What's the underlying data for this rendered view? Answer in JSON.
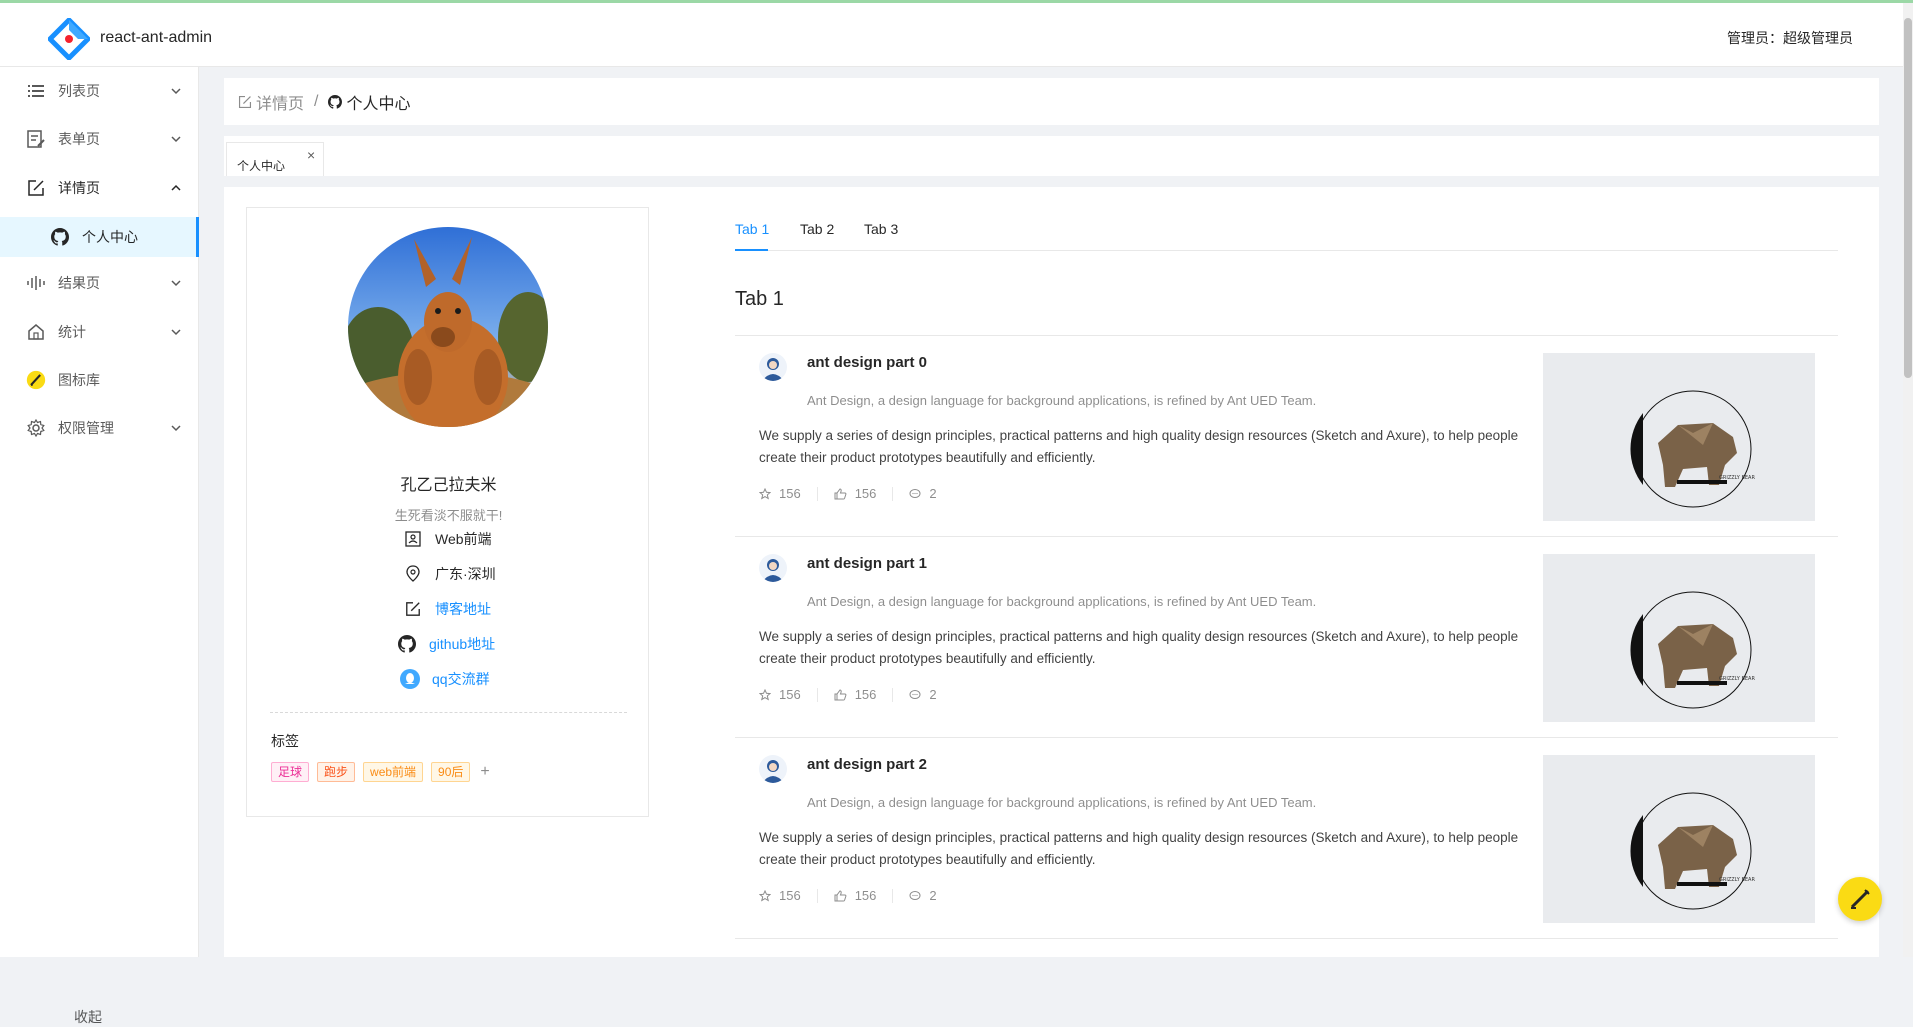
{
  "header": {
    "app_title": "react-ant-admin",
    "admin_label": "管理员：超级管理员"
  },
  "sidebar": {
    "items": [
      {
        "label": "列表页",
        "icon": "list-icon"
      },
      {
        "label": "表单页",
        "icon": "form-icon"
      },
      {
        "label": "详情页",
        "icon": "edit-square-icon"
      },
      {
        "label": "结果页",
        "icon": "audio-bars-icon"
      },
      {
        "label": "统计",
        "icon": "home-icon"
      },
      {
        "label": "图标库",
        "icon": "pencil-sticker-icon"
      },
      {
        "label": "权限管理",
        "icon": "gear-icon"
      }
    ],
    "active_sub": {
      "label": "个人中心",
      "icon": "github-icon"
    },
    "collapse_label": "收起"
  },
  "breadcrumb": {
    "parent": "详情页",
    "current": "个人中心"
  },
  "page_tabs": [
    {
      "label": "个人中心",
      "close": "×"
    }
  ],
  "profile": {
    "name": "孔乙己拉夫米",
    "motto": "生死看淡不服就干!",
    "info": [
      {
        "text": "Web前端",
        "icon": "id-card-icon",
        "link": false
      },
      {
        "text": "广东·深圳",
        "icon": "location-icon",
        "link": false
      },
      {
        "text": "博客地址",
        "icon": "edit-square-icon",
        "link": true
      },
      {
        "text": "github地址",
        "icon": "github-icon",
        "link": true
      },
      {
        "text": "qq交流群",
        "icon": "qq-icon",
        "link": true
      }
    ],
    "tags_title": "标签",
    "tags": [
      "足球",
      "跑步",
      "web前端",
      "90后"
    ],
    "tag_add": "+"
  },
  "main_tabs": [
    "Tab 1",
    "Tab 2",
    "Tab 3"
  ],
  "active_tab_heading": "Tab 1",
  "articles": [
    {
      "title": "ant design part 0",
      "description": "Ant Design, a design language for background applications, is refined by Ant UED Team.",
      "content": "We supply a series of design principles, practical patterns and high quality design resources (Sketch and Axure), to help people create their product prototypes beautifully and efficiently.",
      "stars": "156",
      "likes": "156",
      "messages": "2",
      "cover_caption": "GRIZZLY BEAR"
    },
    {
      "title": "ant design part 1",
      "description": "Ant Design, a design language for background applications, is refined by Ant UED Team.",
      "content": "We supply a series of design principles, practical patterns and high quality design resources (Sketch and Axure), to help people create their product prototypes beautifully and efficiently.",
      "stars": "156",
      "likes": "156",
      "messages": "2",
      "cover_caption": "GRIZZLY BEAR"
    },
    {
      "title": "ant design part 2",
      "description": "Ant Design, a design language for background applications, is refined by Ant UED Team.",
      "content": "We supply a series of design principles, practical patterns and high quality design resources (Sketch and Axure), to help people create their product prototypes beautifully and efficiently.",
      "stars": "156",
      "likes": "156",
      "messages": "2",
      "cover_caption": "GRIZZLY BEAR"
    }
  ],
  "colors": {
    "primary": "#1890ff",
    "background": "#f0f2f5",
    "float_button": "#fadb14"
  }
}
